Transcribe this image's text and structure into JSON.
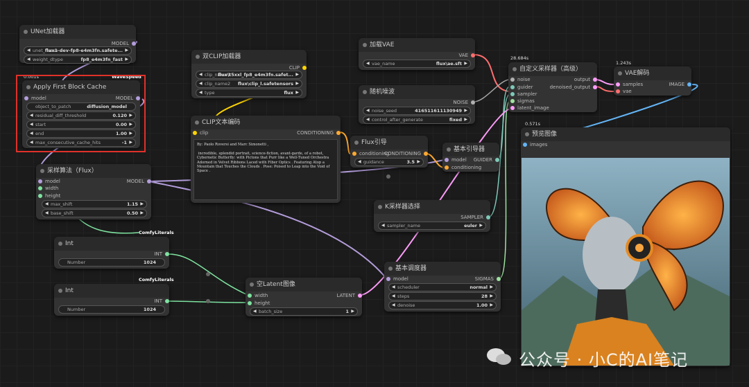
{
  "nodes": {
    "unet_loader": {
      "title": "UNet加载器",
      "output": "MODEL",
      "unet_name_label": "unet_name",
      "unet_name_value": "flux1-dev-fp8-e4m3fn.safete...",
      "weight_dtype_label": "weight_dtype",
      "weight_dtype_value": "fp8_e4m3fn_fast"
    },
    "first_block_cache": {
      "time": "0.001s",
      "badge": "WaveSpeed",
      "title": "Apply First Block Cache",
      "input": "model",
      "output": "MODEL",
      "object_to_patch_label": "object_to_patch",
      "object_to_patch_value": "diffusion_model",
      "residual_label": "residual_diff_threshold",
      "residual_value": "0.120",
      "start_label": "start",
      "start_value": "0.00",
      "end_label": "end",
      "end_value": "1.00",
      "max_hits_label": "max_consecutive_cache_hits",
      "max_hits_value": "-1"
    },
    "dual_clip": {
      "title": "双CLIP加载器",
      "output": "CLIP",
      "clip1_label": "clip_name1",
      "clip1_value": "flux\\t5xxl_fp8_e4m3fn.safet...",
      "clip2_label": "clip_name2",
      "clip2_value": "flux\\clip_l.safetensors",
      "type_label": "type",
      "type_value": "flux"
    },
    "clip_encode": {
      "title": "CLIP文本编码",
      "input": "clip",
      "output": "CONDITIONING",
      "text": "By: Paolo Roversi and Marc Simonetti ,\n\n incredible, splendid portrait, science-fiction, avant-garde, of a robot, Cybernetic Butterfly: with Pictons that Purr like a Well-Tuned Orchestra Adorned in Velvet Ribbons Laced with Fiber Optics . Featuring Atop a Mountain that Touches the Clouds . Pose: Poised to Leap into the Void of Space ."
    },
    "flux_guidance": {
      "title": "Flux引导",
      "input": "conditioning",
      "output": "CONDITIONING",
      "guidance_label": "guidance",
      "guidance_value": "3.5"
    },
    "model_sampling": {
      "title": "采样算法（Flux）",
      "output": "MODEL",
      "in_model": "model",
      "in_width": "width",
      "in_height": "height",
      "max_shift_label": "max_shift",
      "max_shift_value": "1.15",
      "base_shift_label": "base_shift",
      "base_shift_value": "0.50"
    },
    "int1": {
      "badge": "ComfyLiterals",
      "title": "Int",
      "output": "INT",
      "label": "Number",
      "value": "1024"
    },
    "int2": {
      "badge": "ComfyLiterals",
      "title": "Int",
      "output": "INT",
      "label": "Number",
      "value": "1024"
    },
    "empty_latent": {
      "title": "空Latent图像",
      "in_width": "width",
      "in_height": "height",
      "output": "LATENT",
      "batch_label": "batch_size",
      "batch_value": "1"
    },
    "vae_loader": {
      "title": "加载VAE",
      "output": "VAE",
      "vae_label": "vae_name",
      "vae_value": "flux\\ae.sft"
    },
    "noise": {
      "title": "随机噪波",
      "output": "NOISE",
      "seed_label": "noise_seed",
      "seed_value": "416511611130949",
      "ctrl_label": "control_after_generate",
      "ctrl_value": "fixed"
    },
    "basic_guider": {
      "title": "基本引导器",
      "in_model": "model",
      "in_cond": "conditioning",
      "output": "GUIDER"
    },
    "ksampler_select": {
      "title": "K采样器选择",
      "output": "SAMPLER",
      "label": "sampler_name",
      "value": "euler"
    },
    "scheduler": {
      "title": "基本调度器",
      "input": "model",
      "output": "SIGMAS",
      "sched_label": "scheduler",
      "sched_value": "normal",
      "steps_label": "steps",
      "steps_value": "28",
      "denoise_label": "denoise",
      "denoise_value": "1.00"
    },
    "custom_sampler": {
      "time": "28.684s",
      "title": "自定义采样器（高级）",
      "in_noise": "noise",
      "in_guider": "guider",
      "in_sampler": "sampler",
      "in_sigmas": "sigmas",
      "in_latent": "latent_image",
      "out1": "output",
      "out2": "denoised_output"
    },
    "vae_decode": {
      "time": "1.243s",
      "title": "VAE解码",
      "in_samples": "samples",
      "in_vae": "vae",
      "output": "IMAGE"
    },
    "preview": {
      "time": "0.571s",
      "title": "预览图像",
      "input": "images"
    }
  },
  "watermark": "公众号 · 小C的AI笔记",
  "colors": {
    "model": "#b39ddb",
    "clip": "#ffd500",
    "conditioning": "#ffa931",
    "latent": "#ff9cf9",
    "vae": "#ff6e6e",
    "image": "#64b5f6",
    "int": "#7ee3a0",
    "noise": "#b0b0b0",
    "highlight": "#e0312a"
  }
}
